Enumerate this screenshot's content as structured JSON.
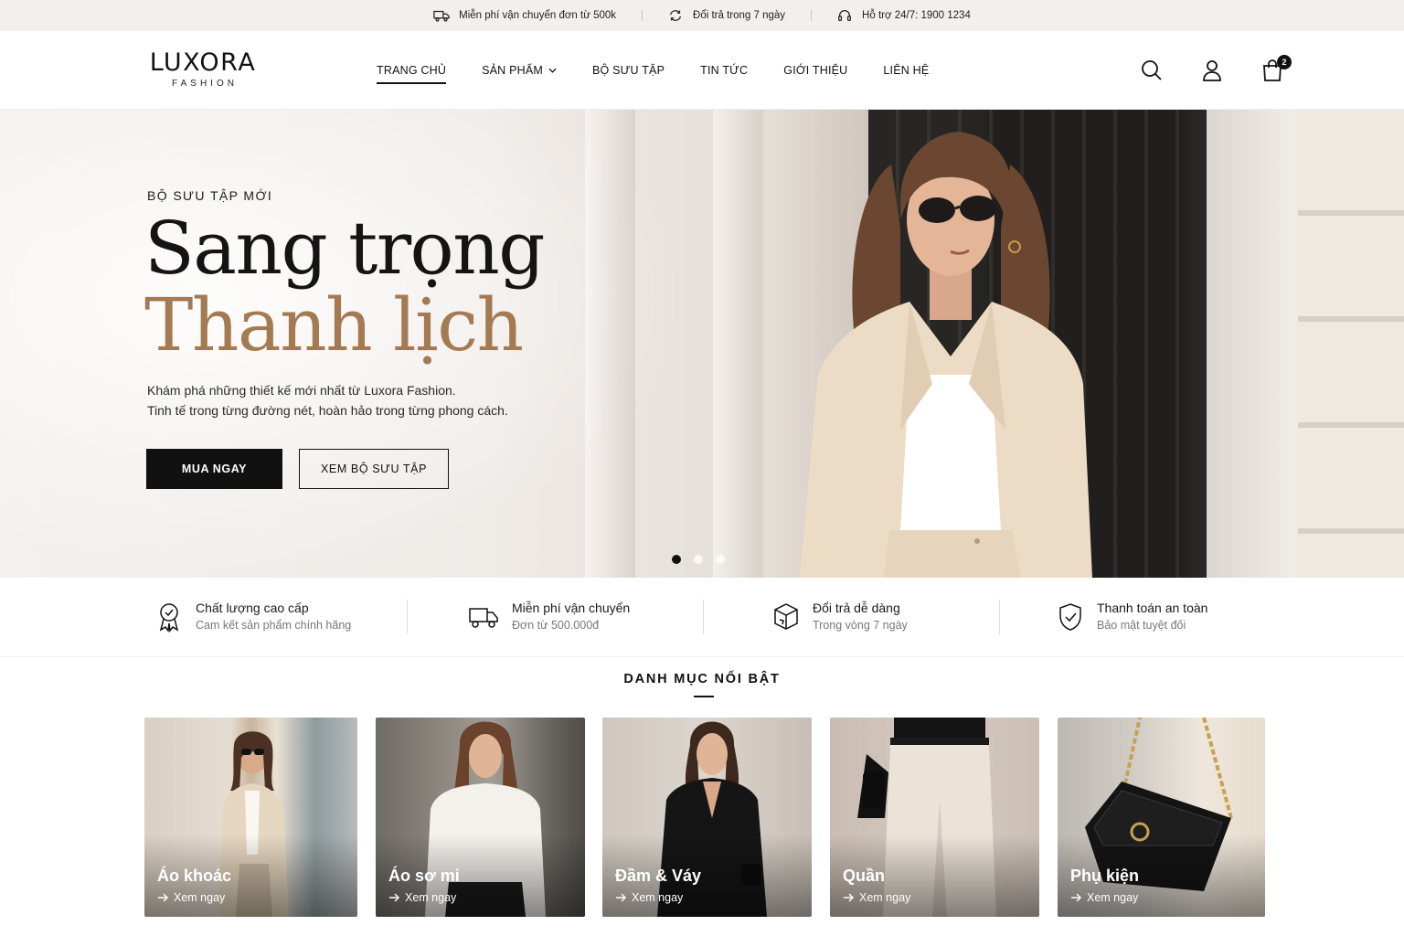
{
  "topbar": {
    "items": [
      {
        "icon": "truck-icon",
        "text": "Miễn phí vận chuyển đơn từ 500k"
      },
      {
        "icon": "refresh-icon",
        "text": "Đổi trả trong 7 ngày"
      },
      {
        "icon": "headset-icon",
        "text": "Hỗ trợ 24/7: 1900 1234"
      }
    ]
  },
  "header": {
    "brand": "LUXORA",
    "brand_sub": "FASHION",
    "nav": [
      {
        "label": "TRANG CHỦ",
        "active": true
      },
      {
        "label": "SẢN PHẨM",
        "has_dropdown": true
      },
      {
        "label": "BỘ SƯU TẬP"
      },
      {
        "label": "TIN TỨC"
      },
      {
        "label": "GIỚI THIỆU"
      },
      {
        "label": "LIÊN HỆ"
      }
    ],
    "cart_count": "2"
  },
  "hero": {
    "eyebrow": "BỘ SƯU TẬP MỚI",
    "title_line1": "Sang trọng",
    "title_line2": "Thanh lịch",
    "lead_line1": "Khám phá những thiết kế mới nhất từ Luxora Fashion.",
    "lead_line2": "Tinh tế trong từng đường nét, hoàn hảo trong từng phong cách.",
    "primary_cta": "MUA NGAY",
    "secondary_cta": "XEM BỘ SƯU TẬP",
    "slides": 3,
    "active_slide": 1
  },
  "features": [
    {
      "icon": "award-icon",
      "title": "Chất lượng cao cấp",
      "subtitle": "Cam kết sản phẩm chính hãng"
    },
    {
      "icon": "truck-icon",
      "title": "Miễn phí vận chuyển",
      "subtitle": "Đơn từ 500.000đ"
    },
    {
      "icon": "box-icon",
      "title": "Đổi trả dễ dàng",
      "subtitle": "Trong vòng 7 ngày"
    },
    {
      "icon": "shield-check-icon",
      "title": "Thanh toán an toàn",
      "subtitle": "Bảo mật tuyệt đối"
    }
  ],
  "categories": {
    "title": "DANH MỤC NỔI BẬT",
    "items": [
      {
        "name": "Áo khoác",
        "link": "Xem ngay"
      },
      {
        "name": "Áo sơ mi",
        "link": "Xem ngay"
      },
      {
        "name": "Đầm & Váy",
        "link": "Xem ngay"
      },
      {
        "name": "Quần",
        "link": "Xem ngay"
      },
      {
        "name": "Phụ kiện",
        "link": "Xem ngay"
      }
    ]
  },
  "colors": {
    "accent_gold": "#a47a52",
    "dark": "#111111",
    "topbar_bg": "#f1f0ef"
  }
}
